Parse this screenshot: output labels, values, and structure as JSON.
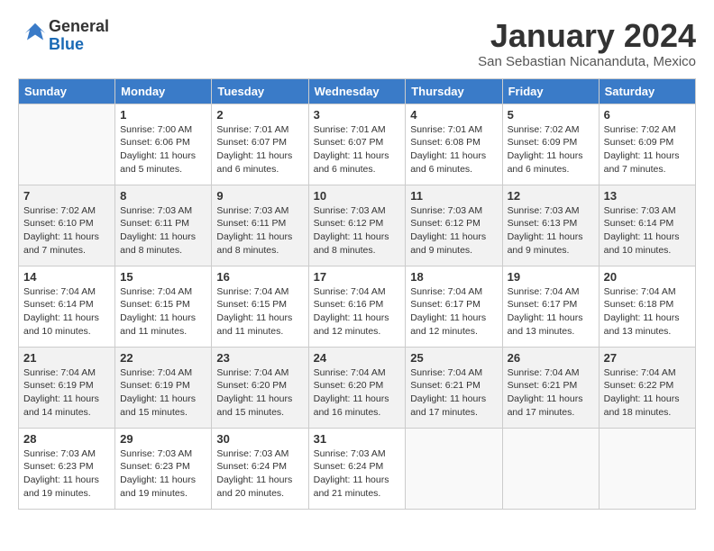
{
  "logo": {
    "general": "General",
    "blue": "Blue"
  },
  "title": "January 2024",
  "subtitle": "San Sebastian Nicananduta, Mexico",
  "days_header": [
    "Sunday",
    "Monday",
    "Tuesday",
    "Wednesday",
    "Thursday",
    "Friday",
    "Saturday"
  ],
  "weeks": [
    [
      {
        "day": "",
        "info": ""
      },
      {
        "day": "1",
        "info": "Sunrise: 7:00 AM\nSunset: 6:06 PM\nDaylight: 11 hours\nand 5 minutes."
      },
      {
        "day": "2",
        "info": "Sunrise: 7:01 AM\nSunset: 6:07 PM\nDaylight: 11 hours\nand 6 minutes."
      },
      {
        "day": "3",
        "info": "Sunrise: 7:01 AM\nSunset: 6:07 PM\nDaylight: 11 hours\nand 6 minutes."
      },
      {
        "day": "4",
        "info": "Sunrise: 7:01 AM\nSunset: 6:08 PM\nDaylight: 11 hours\nand 6 minutes."
      },
      {
        "day": "5",
        "info": "Sunrise: 7:02 AM\nSunset: 6:09 PM\nDaylight: 11 hours\nand 6 minutes."
      },
      {
        "day": "6",
        "info": "Sunrise: 7:02 AM\nSunset: 6:09 PM\nDaylight: 11 hours\nand 7 minutes."
      }
    ],
    [
      {
        "day": "7",
        "info": "Sunrise: 7:02 AM\nSunset: 6:10 PM\nDaylight: 11 hours\nand 7 minutes."
      },
      {
        "day": "8",
        "info": "Sunrise: 7:03 AM\nSunset: 6:11 PM\nDaylight: 11 hours\nand 8 minutes."
      },
      {
        "day": "9",
        "info": "Sunrise: 7:03 AM\nSunset: 6:11 PM\nDaylight: 11 hours\nand 8 minutes."
      },
      {
        "day": "10",
        "info": "Sunrise: 7:03 AM\nSunset: 6:12 PM\nDaylight: 11 hours\nand 8 minutes."
      },
      {
        "day": "11",
        "info": "Sunrise: 7:03 AM\nSunset: 6:12 PM\nDaylight: 11 hours\nand 9 minutes."
      },
      {
        "day": "12",
        "info": "Sunrise: 7:03 AM\nSunset: 6:13 PM\nDaylight: 11 hours\nand 9 minutes."
      },
      {
        "day": "13",
        "info": "Sunrise: 7:03 AM\nSunset: 6:14 PM\nDaylight: 11 hours\nand 10 minutes."
      }
    ],
    [
      {
        "day": "14",
        "info": "Sunrise: 7:04 AM\nSunset: 6:14 PM\nDaylight: 11 hours\nand 10 minutes."
      },
      {
        "day": "15",
        "info": "Sunrise: 7:04 AM\nSunset: 6:15 PM\nDaylight: 11 hours\nand 11 minutes."
      },
      {
        "day": "16",
        "info": "Sunrise: 7:04 AM\nSunset: 6:15 PM\nDaylight: 11 hours\nand 11 minutes."
      },
      {
        "day": "17",
        "info": "Sunrise: 7:04 AM\nSunset: 6:16 PM\nDaylight: 11 hours\nand 12 minutes."
      },
      {
        "day": "18",
        "info": "Sunrise: 7:04 AM\nSunset: 6:17 PM\nDaylight: 11 hours\nand 12 minutes."
      },
      {
        "day": "19",
        "info": "Sunrise: 7:04 AM\nSunset: 6:17 PM\nDaylight: 11 hours\nand 13 minutes."
      },
      {
        "day": "20",
        "info": "Sunrise: 7:04 AM\nSunset: 6:18 PM\nDaylight: 11 hours\nand 13 minutes."
      }
    ],
    [
      {
        "day": "21",
        "info": "Sunrise: 7:04 AM\nSunset: 6:19 PM\nDaylight: 11 hours\nand 14 minutes."
      },
      {
        "day": "22",
        "info": "Sunrise: 7:04 AM\nSunset: 6:19 PM\nDaylight: 11 hours\nand 15 minutes."
      },
      {
        "day": "23",
        "info": "Sunrise: 7:04 AM\nSunset: 6:20 PM\nDaylight: 11 hours\nand 15 minutes."
      },
      {
        "day": "24",
        "info": "Sunrise: 7:04 AM\nSunset: 6:20 PM\nDaylight: 11 hours\nand 16 minutes."
      },
      {
        "day": "25",
        "info": "Sunrise: 7:04 AM\nSunset: 6:21 PM\nDaylight: 11 hours\nand 17 minutes."
      },
      {
        "day": "26",
        "info": "Sunrise: 7:04 AM\nSunset: 6:21 PM\nDaylight: 11 hours\nand 17 minutes."
      },
      {
        "day": "27",
        "info": "Sunrise: 7:04 AM\nSunset: 6:22 PM\nDaylight: 11 hours\nand 18 minutes."
      }
    ],
    [
      {
        "day": "28",
        "info": "Sunrise: 7:03 AM\nSunset: 6:23 PM\nDaylight: 11 hours\nand 19 minutes."
      },
      {
        "day": "29",
        "info": "Sunrise: 7:03 AM\nSunset: 6:23 PM\nDaylight: 11 hours\nand 19 minutes."
      },
      {
        "day": "30",
        "info": "Sunrise: 7:03 AM\nSunset: 6:24 PM\nDaylight: 11 hours\nand 20 minutes."
      },
      {
        "day": "31",
        "info": "Sunrise: 7:03 AM\nSunset: 6:24 PM\nDaylight: 11 hours\nand 21 minutes."
      },
      {
        "day": "",
        "info": ""
      },
      {
        "day": "",
        "info": ""
      },
      {
        "day": "",
        "info": ""
      }
    ]
  ]
}
